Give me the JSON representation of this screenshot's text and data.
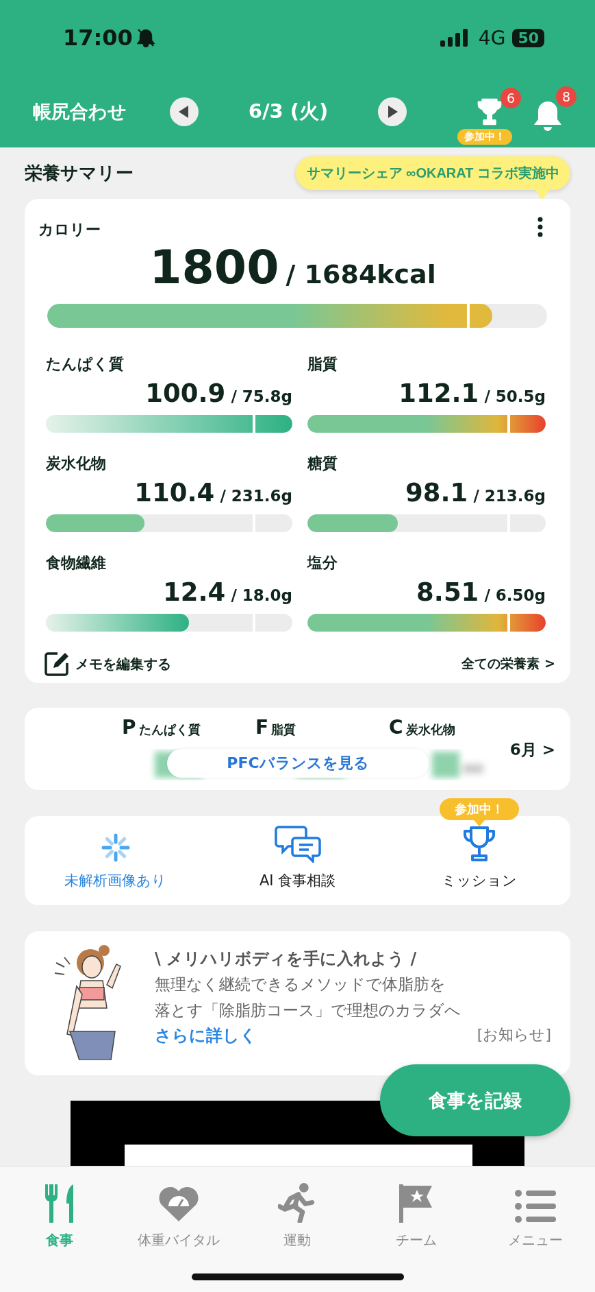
{
  "status_bar": {
    "time": "17:00",
    "network": "4G",
    "battery": "50"
  },
  "header": {
    "title": "帳尻合わせ",
    "date": "6/3 (火)",
    "trophy_count": "6",
    "trophy_tag": "参加中！",
    "bell_count": "8"
  },
  "summary": {
    "title": "栄養サマリー",
    "tooltip": "サマリーシェア ∞OKARAT コラボ実施中",
    "calorie": {
      "label": "カロリー",
      "value": "1800",
      "target": "/ 1684kcal",
      "kind": "caution",
      "level": 0.89
    },
    "nutrients": [
      {
        "label": "たんぱく質",
        "value": "100.9",
        "target": "/ 75.8g",
        "kind": "fade",
        "level": 1
      },
      {
        "label": "脂質",
        "value": "112.1",
        "target": "/ 50.5g",
        "kind": "warn",
        "level": 1
      },
      {
        "label": "炭水化物",
        "value": "110.4",
        "target": "/ 231.6g",
        "kind": "flat",
        "level": 0.4
      },
      {
        "label": "糖質",
        "value": "98.1",
        "target": "/ 213.6g",
        "kind": "flat",
        "level": 0.38
      },
      {
        "label": "食物繊維",
        "value": "12.4",
        "target": "/ 18.0g",
        "kind": "fade",
        "level": 0.58
      },
      {
        "label": "塩分",
        "value": "8.51",
        "target": "/ 6.50g",
        "kind": "warn",
        "level": 1
      }
    ],
    "memo": "メモを編集する",
    "all_link": "全ての栄養素 >"
  },
  "pfc": {
    "items": [
      {
        "letter": "P",
        "label": "たんぱく質"
      },
      {
        "letter": "F",
        "label": "脂質"
      },
      {
        "letter": "C",
        "label": "炭水化物"
      }
    ],
    "month": "6月 >",
    "button": "PFCバランスを見る"
  },
  "shortcuts": [
    {
      "kind": "spinner",
      "label": "未解析画像あり",
      "active": true
    },
    {
      "kind": "chat",
      "label": "AI 食事相談",
      "active": false
    },
    {
      "kind": "trophy",
      "label": "ミッション",
      "active": false,
      "tag": "参加中！"
    }
  ],
  "banner": {
    "headline": "\\ メリハリボディを手に入れよう /",
    "body_lines": [
      "無理なく継続できるメソッドで体脂肪を",
      "落とす「除脂肪コース」で理想のカラダへ"
    ],
    "link": "さらに詳しく",
    "tag": "[お知らせ]"
  },
  "fab": "食事を記録",
  "tabs": [
    {
      "kind": "meal",
      "label": "食事",
      "selected": true
    },
    {
      "kind": "weight",
      "label": "体重バイタル",
      "selected": false
    },
    {
      "kind": "exercise",
      "label": "運動",
      "selected": false
    },
    {
      "kind": "team",
      "label": "チーム",
      "selected": false
    },
    {
      "kind": "menu",
      "label": "メニュー",
      "selected": false
    }
  ]
}
